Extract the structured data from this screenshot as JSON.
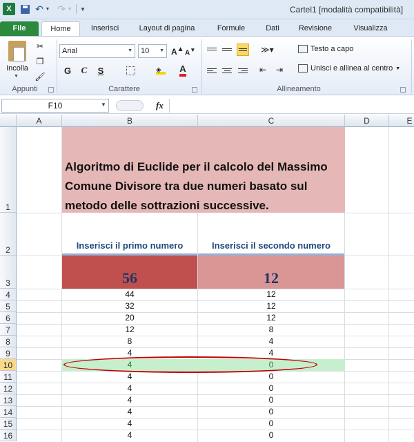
{
  "titlebar": {
    "app_icon": "X",
    "title": "Cartel1  [modalità compatibilità]"
  },
  "tabs": [
    "File",
    "Home",
    "Inserisci",
    "Layout di pagina",
    "Formule",
    "Dati",
    "Revisione",
    "Visualizza"
  ],
  "ribbon": {
    "paste_label": "Incolla",
    "font_name": "Arial",
    "font_size": "10",
    "bold": "G",
    "italic": "C",
    "underline": "S",
    "wrap_text": "Testo a capo",
    "merge_center": "Unisci e allinea al centro",
    "groups": {
      "clipboard": "Appunti",
      "font": "Carattere",
      "alignment": "Allineamento"
    }
  },
  "formula_bar": {
    "name_box": "F10",
    "fx": "fx",
    "formula": ""
  },
  "grid": {
    "columns": [
      "A",
      "B",
      "C",
      "D",
      "E"
    ],
    "rows": [
      "1",
      "2",
      "3",
      "4",
      "5",
      "6",
      "7",
      "8",
      "9",
      "10",
      "11",
      "12",
      "13",
      "14",
      "15",
      "16"
    ],
    "active_row": "10",
    "title": "Algoritmo di Euclide per il calcolo del Massimo Comune Divisore tra due numeri basato sul metodo delle sottrazioni successive.",
    "label_first": "Inserisci il primo numero",
    "label_second": "Inserisci il secondo numero",
    "input_first": "56",
    "input_second": "12",
    "steps": [
      {
        "b": "44",
        "c": "12"
      },
      {
        "b": "32",
        "c": "12"
      },
      {
        "b": "20",
        "c": "12"
      },
      {
        "b": "12",
        "c": "8"
      },
      {
        "b": "8",
        "c": "4"
      },
      {
        "b": "4",
        "c": "4"
      },
      {
        "b": "4",
        "c": "0"
      },
      {
        "b": "4",
        "c": "0"
      },
      {
        "b": "4",
        "c": "0"
      },
      {
        "b": "4",
        "c": "0"
      },
      {
        "b": "4",
        "c": "0"
      },
      {
        "b": "4",
        "c": "0"
      },
      {
        "b": "4",
        "c": "0"
      }
    ]
  },
  "colors": {
    "title_fill": "#e5b8b7",
    "first_input_fill": "#c0504d",
    "second_input_fill": "#d99694",
    "result_fill": "#c6efce",
    "highlight_oval": "#c00000"
  }
}
